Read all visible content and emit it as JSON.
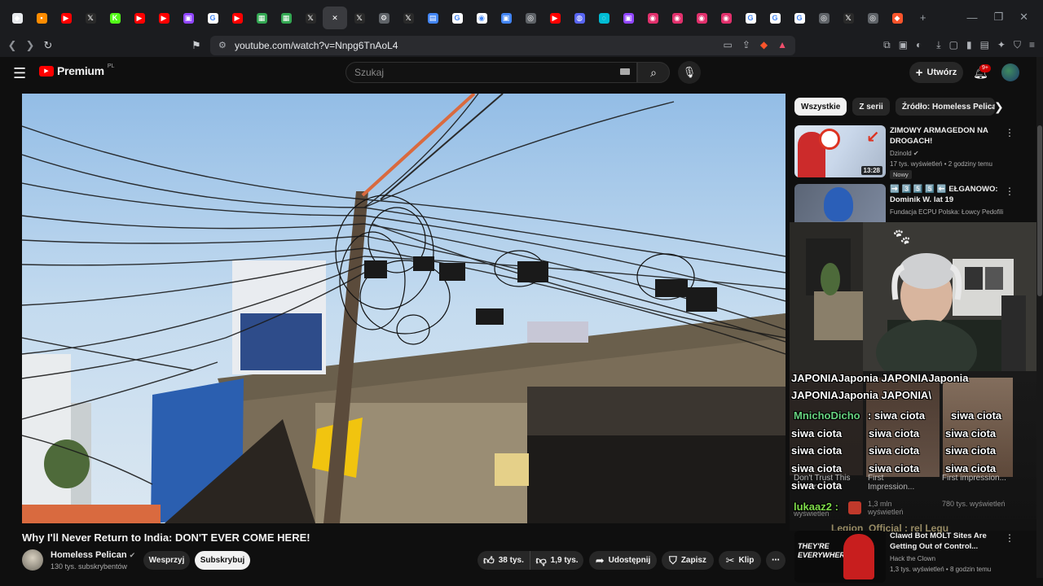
{
  "browser": {
    "tabs": [
      {
        "icon": "brave-icon",
        "color": "#e8eaed",
        "glyph": "◆"
      },
      {
        "icon": "orange-dot-icon",
        "color": "#ff8c00",
        "glyph": "▪"
      },
      {
        "icon": "youtube-icon",
        "color": "#ff0000",
        "glyph": "▶"
      },
      {
        "icon": "x-icon",
        "color": "#2a2a2a",
        "glyph": "𝕏"
      },
      {
        "icon": "kick-icon",
        "color": "#53fc18",
        "glyph": "K"
      },
      {
        "icon": "youtube-icon",
        "color": "#ff0000",
        "glyph": "▶"
      },
      {
        "icon": "youtube-icon",
        "color": "#ff0000",
        "glyph": "▶"
      },
      {
        "icon": "twitch-icon",
        "color": "#9146ff",
        "glyph": "▣"
      },
      {
        "icon": "google-icon",
        "color": "#ffffff",
        "glyph": "G"
      },
      {
        "icon": "youtube-icon",
        "color": "#ff0000",
        "glyph": "▶"
      },
      {
        "icon": "sheets-icon",
        "color": "#34a853",
        "glyph": "▦"
      },
      {
        "icon": "sheets-icon",
        "color": "#34a853",
        "glyph": "▦"
      },
      {
        "icon": "x-icon",
        "color": "#2a2a2a",
        "glyph": "𝕏"
      },
      {
        "icon": "close-icon",
        "color": "#3a3b3f",
        "glyph": "✕"
      },
      {
        "icon": "x-icon",
        "color": "#2a2a2a",
        "glyph": "𝕏"
      },
      {
        "icon": "settings-icon",
        "color": "#5f6368",
        "glyph": "⚙"
      },
      {
        "icon": "x-icon",
        "color": "#2a2a2a",
        "glyph": "𝕏"
      },
      {
        "icon": "docs-icon",
        "color": "#4285f4",
        "glyph": "▤"
      },
      {
        "icon": "google-icon",
        "color": "#ffffff",
        "glyph": "G"
      },
      {
        "icon": "camera-icon",
        "color": "#ffffff",
        "glyph": "◉"
      },
      {
        "icon": "app-icon",
        "color": "#4285f4",
        "glyph": "▣"
      },
      {
        "icon": "globe-icon",
        "color": "#5f6368",
        "glyph": "◎"
      },
      {
        "icon": "youtube-icon",
        "color": "#ff0000",
        "glyph": "▶"
      },
      {
        "icon": "discord-icon",
        "color": "#5865f2",
        "glyph": "◍"
      },
      {
        "icon": "loading-icon",
        "color": "#00bcd4",
        "glyph": "◌"
      },
      {
        "icon": "twitch-icon",
        "color": "#9146ff",
        "glyph": "▣"
      },
      {
        "icon": "instagram-icon",
        "color": "#e1306c",
        "glyph": "◉"
      },
      {
        "icon": "instagram-icon",
        "color": "#e1306c",
        "glyph": "◉"
      },
      {
        "icon": "instagram-icon",
        "color": "#e1306c",
        "glyph": "◉"
      },
      {
        "icon": "instagram-icon",
        "color": "#e1306c",
        "glyph": "◉"
      },
      {
        "icon": "google-icon",
        "color": "#ffffff",
        "glyph": "G"
      },
      {
        "icon": "google-icon",
        "color": "#ffffff",
        "glyph": "G"
      },
      {
        "icon": "google-icon",
        "color": "#ffffff",
        "glyph": "G"
      },
      {
        "icon": "globe-icon",
        "color": "#5f6368",
        "glyph": "◎"
      },
      {
        "icon": "x-icon",
        "color": "#2a2a2a",
        "glyph": "𝕏"
      },
      {
        "icon": "globe-icon",
        "color": "#5f6368",
        "glyph": "◎"
      },
      {
        "icon": "brave-icon",
        "color": "#fb542b",
        "glyph": "◆"
      }
    ],
    "url": "youtube.com/watch?v=Nnpg6TnAoL4"
  },
  "header": {
    "logo_text": "Premium",
    "logo_sup": "PL",
    "search_placeholder": "Szukaj",
    "create_label": "Utwórz",
    "notif_count": "9+"
  },
  "video": {
    "title": "Why I'll Never Return to India: DON'T EVER COME HERE!",
    "channel": "Homeless Pelican",
    "subs": "130 tys. subskrybentów",
    "support_label": "Wesprzyj",
    "subscribe_label": "Subskrybuj",
    "likes": "38 tys.",
    "dislikes": "1,9 tys.",
    "share_label": "Udostępnij",
    "save_label": "Zapisz",
    "clip_label": "Klip"
  },
  "sidebar": {
    "chips": [
      "Wszystkie",
      "Z serii",
      "Źródło: Homeless Pelican"
    ],
    "recs": [
      {
        "title": "ZIMOWY ARMAGEDON NA DROGACH!",
        "channel": "Dzinold",
        "meta": "17 tys. wyświetleń • 2 godziny temu",
        "duration": "13:28",
        "badge": "Nowy",
        "thumb_a": "#c9d7ea",
        "thumb_b": "#cc2b2b"
      },
      {
        "title": "➡️ 3️⃣ 5️⃣ 5️⃣ ⬅️ EŁGANOWO: Dominik W. lat 19",
        "channel": "Fundacja ECPU Polska: Łowcy Pedofili",
        "meta": "",
        "duration": "",
        "badge": "",
        "thumb_a": "#4a5568",
        "thumb_b": "#2b5fb8"
      },
      {
        "title": "Clawd Bot MOLT Sites Are Getting Out of Control...",
        "channel": "Hack the Clown",
        "meta": "1,3 tys. wyświetleń • 8 godzin temu",
        "duration": "",
        "badge": "",
        "thumb_a": "#111111",
        "thumb_b": "#c81e1e"
      }
    ],
    "overlay_recs": [
      {
        "title": "Don't Trust This Man in...",
        "meta": "wyświetleń"
      },
      {
        "title": "First Impression...",
        "meta": "1,3 mln wyświetleń"
      },
      {
        "title": "First impression...",
        "meta": "780 tys. wyświetleń"
      }
    ],
    "thumb_text": "THEY'RE EVERYWHERE"
  },
  "chat": {
    "lines": [
      "JAPONIAJaponia JAPONIAJaponia",
      "JAPONIAJaponia JAPONIA\\",
      ": siwa ciota",
      "siwa ciota",
      "siwa ciota",
      "siwa ciota",
      "siwa ciota",
      "siwa ciota",
      "siwa ciota",
      "siwa ciota",
      "siwa ciota",
      "siwa ciota",
      "siwa ciota"
    ],
    "user1": "MnichoDicho",
    "user2": "lukaaz2 :",
    "faded": "Legion_Official : rel Legu"
  },
  "colors": {
    "accent": "#ff0000",
    "chat_user1": "#66d17f",
    "chat_user2": "#7fdc4a"
  }
}
